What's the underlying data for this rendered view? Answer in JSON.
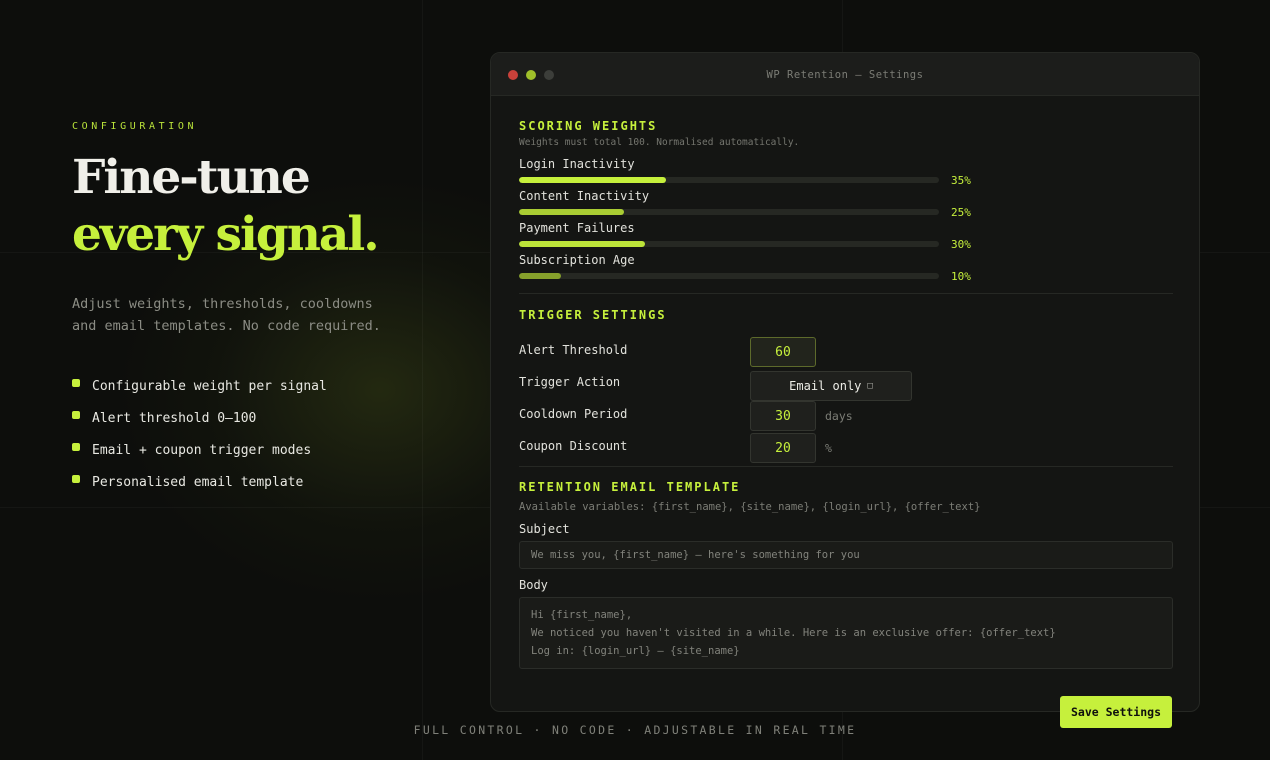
{
  "hero": {
    "eyebrow": "CONFIGURATION",
    "title_line1": "Fine-tune",
    "title_line2": "every signal.",
    "lead": "Adjust weights, thresholds, cooldowns and email templates. No code required.",
    "features": [
      "Configurable weight per signal",
      "Alert threshold 0–100",
      "Email + coupon trigger modes",
      "Personalised email template"
    ]
  },
  "window": {
    "title": "WP Retention — Settings"
  },
  "scoring": {
    "title": "SCORING WEIGHTS",
    "subtitle": "Weights must total 100. Normalised automatically.",
    "weights": [
      {
        "label": "Login Inactivity",
        "value": 35,
        "display": "35%"
      },
      {
        "label": "Content Inactivity",
        "value": 25,
        "display": "25%"
      },
      {
        "label": "Payment Failures",
        "value": 30,
        "display": "30%"
      },
      {
        "label": "Subscription Age",
        "value": 10,
        "display": "10%"
      }
    ],
    "fill_colors": [
      "#c6f03c",
      "#a9cc33",
      "#bce339",
      "#86a02b"
    ]
  },
  "trigger": {
    "title": "TRIGGER SETTINGS",
    "alert_threshold_label": "Alert Threshold",
    "alert_threshold_value": "60",
    "trigger_action_label": "Trigger Action",
    "trigger_action_value": "Email only",
    "cooldown_label": "Cooldown Period",
    "cooldown_value": "30",
    "cooldown_unit": "days",
    "coupon_label": "Coupon Discount",
    "coupon_value": "20",
    "coupon_unit": "%"
  },
  "email": {
    "title": "RETENTION EMAIL TEMPLATE",
    "variables": "Available variables: {first_name}, {site_name}, {login_url}, {offer_text}",
    "subject_label": "Subject",
    "subject_value": "We miss you, {first_name} — here's something for you",
    "body_label": "Body",
    "body_lines": [
      "Hi {first_name},",
      "We noticed you haven't visited in a while. Here is an exclusive offer: {offer_text}",
      "Log in: {login_url} — {site_name}"
    ]
  },
  "save_label": "Save Settings",
  "footer": "FULL CONTROL · NO CODE · ADJUSTABLE IN REAL TIME",
  "colors": {
    "accent": "#c6f03c",
    "background": "#0d0e0c",
    "window": "#141513"
  }
}
